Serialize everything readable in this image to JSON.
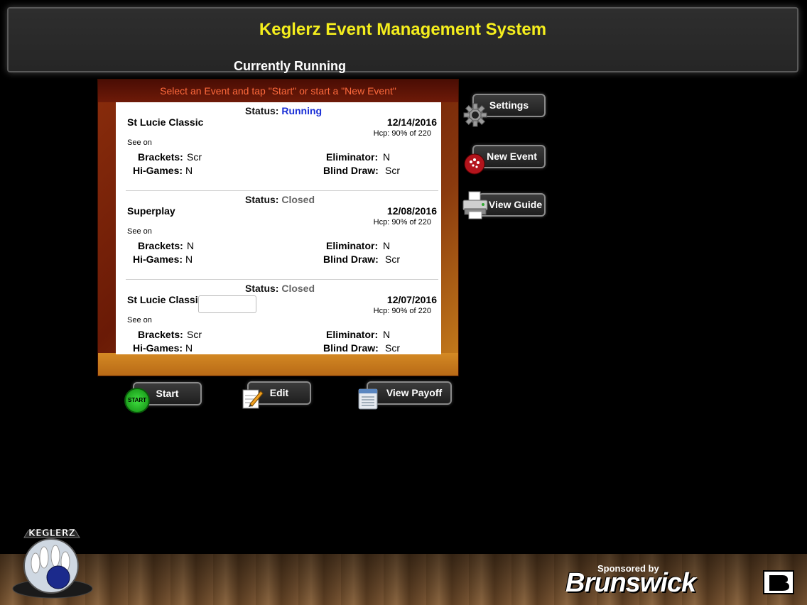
{
  "header": {
    "title": "Keglerz Event Management System"
  },
  "section_title": "Currently Running",
  "instruction": "Select an Event and tap \"Start\" or start a \"New Event\"",
  "labels": {
    "status": "Status:",
    "see": "See  on",
    "brackets": "Brackets:",
    "hi_games": "Hi-Games:",
    "eliminator": "Eliminator:",
    "blind_draw": "Blind Draw:"
  },
  "events": [
    {
      "status": "Running",
      "name": "St Lucie Classic",
      "date": "12/14/2016",
      "hcp": "Hcp: 90% of 220",
      "brackets": "Scr",
      "hi_games": "N",
      "eliminator": "N",
      "blind_draw": "Scr"
    },
    {
      "status": "Closed",
      "name": "Superplay",
      "date": "12/08/2016",
      "hcp": "Hcp: 90% of 220",
      "brackets": "N",
      "hi_games": "N",
      "eliminator": "N",
      "blind_draw": "Scr"
    },
    {
      "status": "Closed",
      "name": "St Lucie Classi",
      "date": "12/07/2016",
      "hcp": "Hcp: 90% of 220",
      "brackets": "Scr",
      "hi_games": "N",
      "eliminator": "N",
      "blind_draw": "Scr"
    }
  ],
  "side_buttons": {
    "settings": "Settings",
    "new_event": "New Event",
    "view_guide": "View Guide"
  },
  "bottom_buttons": {
    "start": "Start",
    "start_icon_text": "START",
    "edit": "Edit",
    "view_payoff": "View Payoff"
  },
  "logo": {
    "text": "KEGLERZ"
  },
  "sponsor": {
    "label": "Sponsored by",
    "brand": "Brunswick"
  },
  "colors": {
    "title": "#f5ee1d",
    "running": "#1a2fd6",
    "closed": "#666666",
    "instruction": "#ff6a3c"
  }
}
